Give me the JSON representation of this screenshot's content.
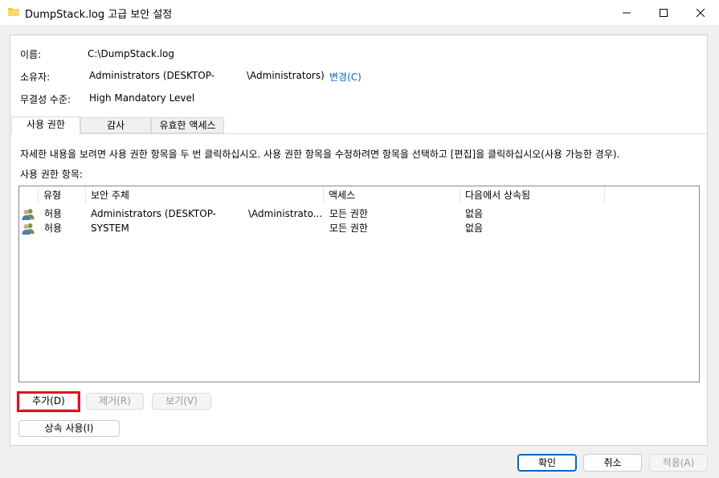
{
  "window": {
    "title": "DumpStack.log 고급 보안 설정",
    "controls": [
      "minimize-icon",
      "maximize-icon",
      "close-icon"
    ]
  },
  "info": {
    "name_label": "이름:",
    "name_value": "C:\\DumpStack.log",
    "owner_label": "소유자:",
    "owner_value_part1": "Administrators (DESKTOP-",
    "owner_value_part2": "\\Administrators)",
    "owner_change_link": "변경(C)",
    "integrity_label": "무결성 수준:",
    "integrity_value": "High Mandatory Level"
  },
  "tabs": [
    {
      "label": "사용 권한",
      "active": true
    },
    {
      "label": "감사",
      "active": false
    },
    {
      "label": "유효한 액세스",
      "active": false
    }
  ],
  "permissions": {
    "instructions": "자세한 내용을 보려면 사용 권한 항목을 두 번 클릭하십시오. 사용 권한 항목을 수정하려면 항목을 선택하고 [편집]을 클릭하십시오(사용 가능한 경우).",
    "entries_label": "사용 권한 항목:",
    "columns": [
      "유형",
      "보안 주체",
      "액세스",
      "다음에서 상속됨"
    ],
    "rows": [
      {
        "icon": "users-icon",
        "type": "허용",
        "principal_part1": "Administrators (DESKTOP-",
        "principal_part2": "\\Administrato...",
        "access": "모든 권한",
        "inherited": "없음"
      },
      {
        "icon": "users-icon",
        "type": "허용",
        "principal_part1": "SYSTEM",
        "principal_part2": "",
        "access": "모든 권한",
        "inherited": "없음"
      }
    ]
  },
  "buttons": {
    "add": "추가(D)",
    "remove": "제거(R)",
    "view": "보기(V)",
    "enable_inheritance": "상속 사용(I)",
    "ok": "확인",
    "cancel": "취소",
    "apply": "적용(A)"
  },
  "colors": {
    "highlight_box": "#e01020",
    "link": "#0066cc",
    "folder_icon": "#f5c542"
  }
}
